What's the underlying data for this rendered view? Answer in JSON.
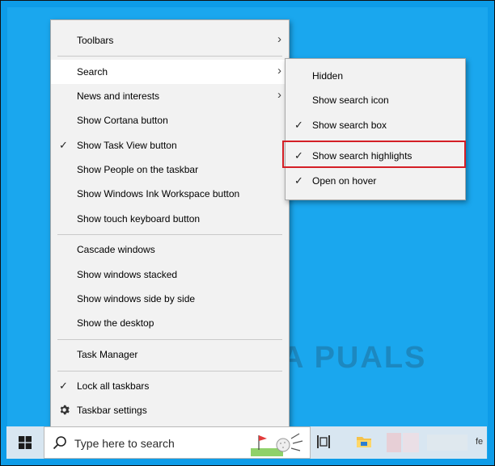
{
  "context_menu": {
    "items": [
      {
        "label": "Toolbars",
        "checked": false,
        "submenu": true
      },
      {
        "label": "Search",
        "checked": false,
        "submenu": true,
        "hovered": true
      },
      {
        "label": "News and interests",
        "checked": false,
        "submenu": true
      },
      {
        "label": "Show Cortana button",
        "checked": false
      },
      {
        "label": "Show Task View button",
        "checked": true
      },
      {
        "label": "Show People on the taskbar",
        "checked": false
      },
      {
        "label": "Show Windows Ink Workspace button",
        "checked": false
      },
      {
        "label": "Show touch keyboard button",
        "checked": false
      },
      {
        "label": "Cascade windows",
        "checked": false
      },
      {
        "label": "Show windows stacked",
        "checked": false
      },
      {
        "label": "Show windows side by side",
        "checked": false
      },
      {
        "label": "Show the desktop",
        "checked": false
      },
      {
        "label": "Task Manager",
        "checked": false
      },
      {
        "label": "Lock all taskbars",
        "checked": true
      },
      {
        "label": "Taskbar settings",
        "checked": false,
        "icon": "gear-icon"
      }
    ],
    "check_glyph": "✓",
    "arrow_glyph": "›"
  },
  "search_submenu": {
    "items": [
      {
        "label": "Hidden",
        "checked": false
      },
      {
        "label": "Show search icon",
        "checked": false
      },
      {
        "label": "Show search box",
        "checked": true
      },
      {
        "label": "Show search highlights",
        "checked": true,
        "highlighted": true
      },
      {
        "label": "Open on hover",
        "checked": true
      }
    ]
  },
  "taskbar": {
    "search_placeholder": "Type here to search",
    "clock_fragment": "fe"
  },
  "watermark": {
    "text": "A  PUALS"
  },
  "colors": {
    "desktop": "#1aa7ee",
    "menu_bg": "#f2f2f2",
    "highlight_border": "#d41f26",
    "taskbar": "#d8e6f1"
  }
}
